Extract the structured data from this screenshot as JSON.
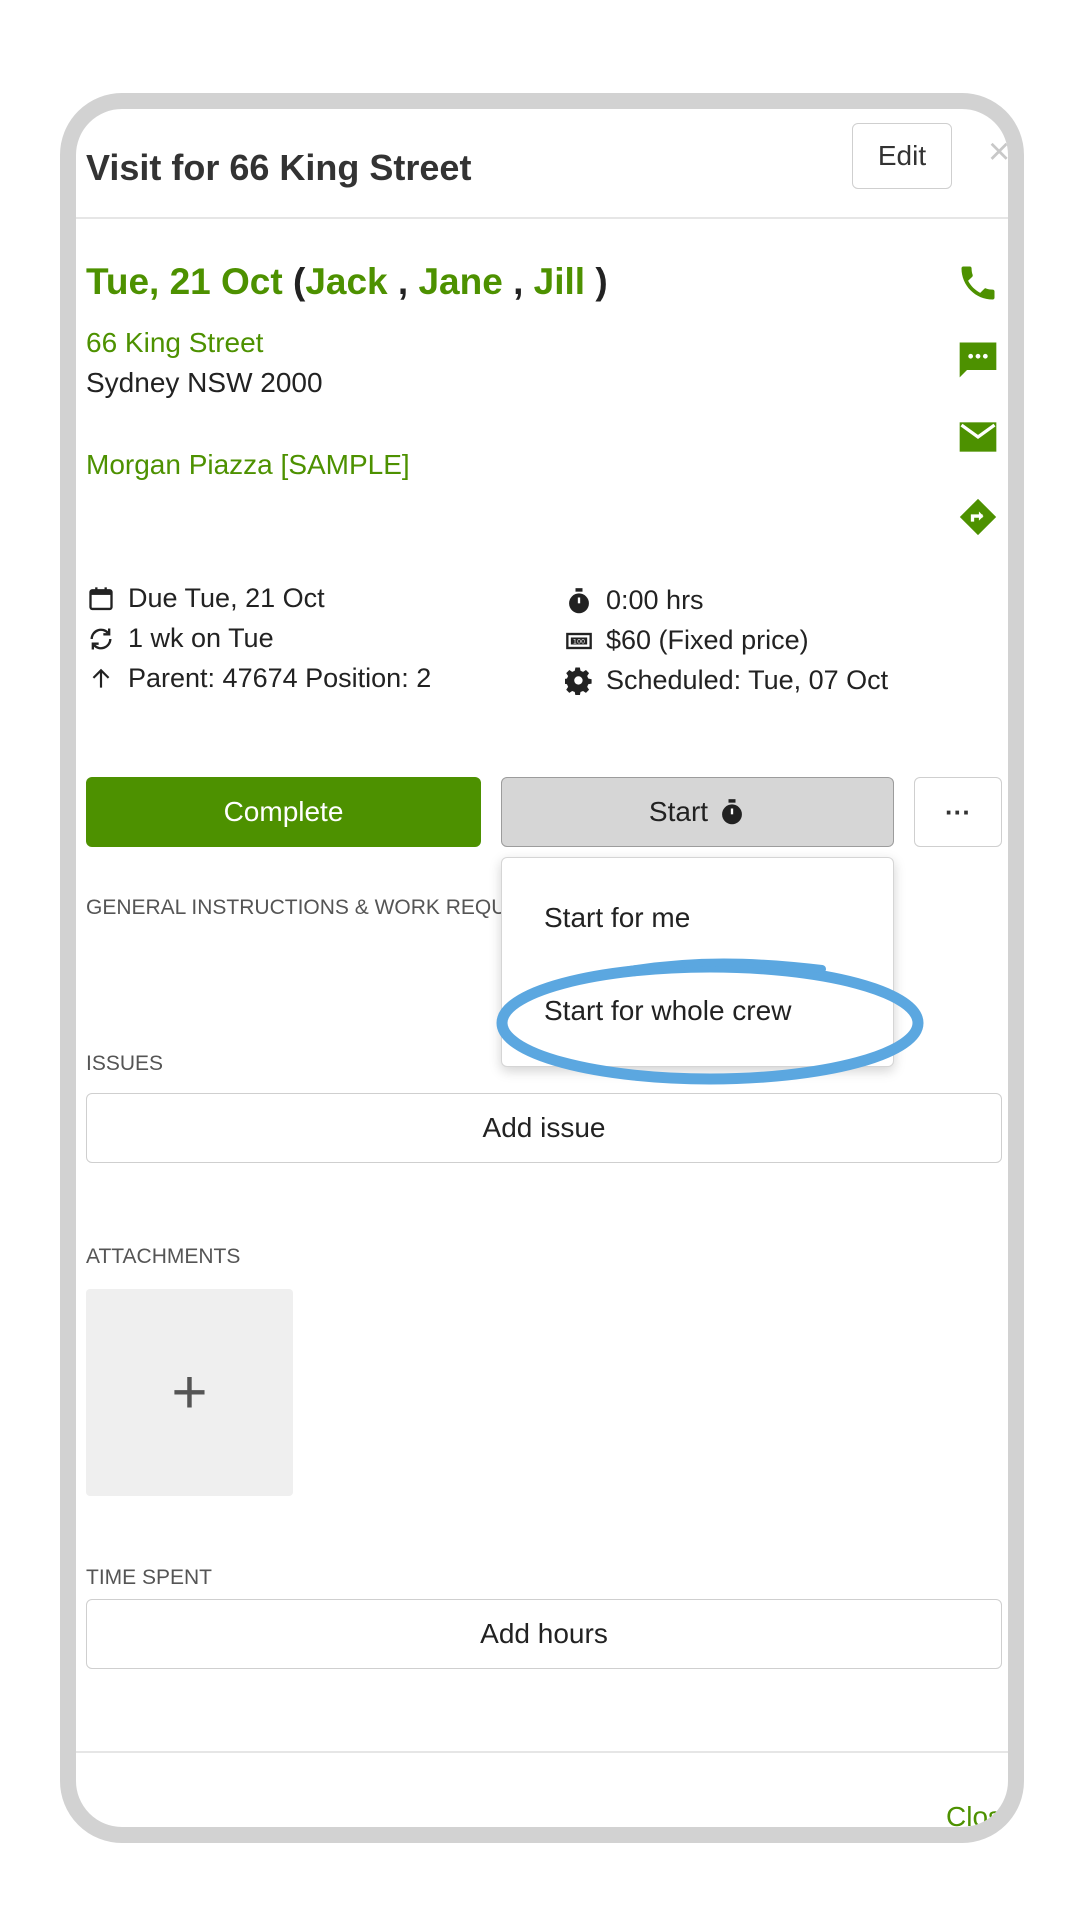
{
  "header": {
    "title": "Visit for 66 King Street",
    "edit_label": "Edit",
    "close_icon": "×"
  },
  "visit": {
    "date": "Tue, 21 Oct",
    "crew": [
      "Jack",
      "Jane",
      "Jill"
    ],
    "address_line1": "66 King Street",
    "address_line2": "Sydney NSW 2000",
    "client": "Morgan Piazza [SAMPLE]"
  },
  "contact_icons": [
    "phone-icon",
    "sms-icon",
    "email-icon",
    "directions-icon"
  ],
  "details": {
    "due": "Due Tue, 21 Oct",
    "recurrence": "1 wk on Tue",
    "parent": "Parent: 47674 Position: 2",
    "duration": "0:00 hrs",
    "price": "$60 (Fixed price)",
    "scheduled": "Scheduled: Tue, 07 Oct"
  },
  "actions": {
    "complete_label": "Complete",
    "start_label": "Start",
    "more_label": "···"
  },
  "start_menu": {
    "items": [
      "Start for me",
      "Start for whole crew"
    ]
  },
  "sections": {
    "instructions": "GENERAL INSTRUCTIONS & WORK REQU",
    "issues": "ISSUES",
    "add_issue": "Add issue",
    "attachments": "ATTACHMENTS",
    "add_attachment": "+",
    "time_spent": "TIME SPENT",
    "add_hours": "Add hours"
  },
  "footer": {
    "close_label": "Clos"
  },
  "colors": {
    "accent": "#4d9100",
    "highlight": "#5ba7e0"
  }
}
